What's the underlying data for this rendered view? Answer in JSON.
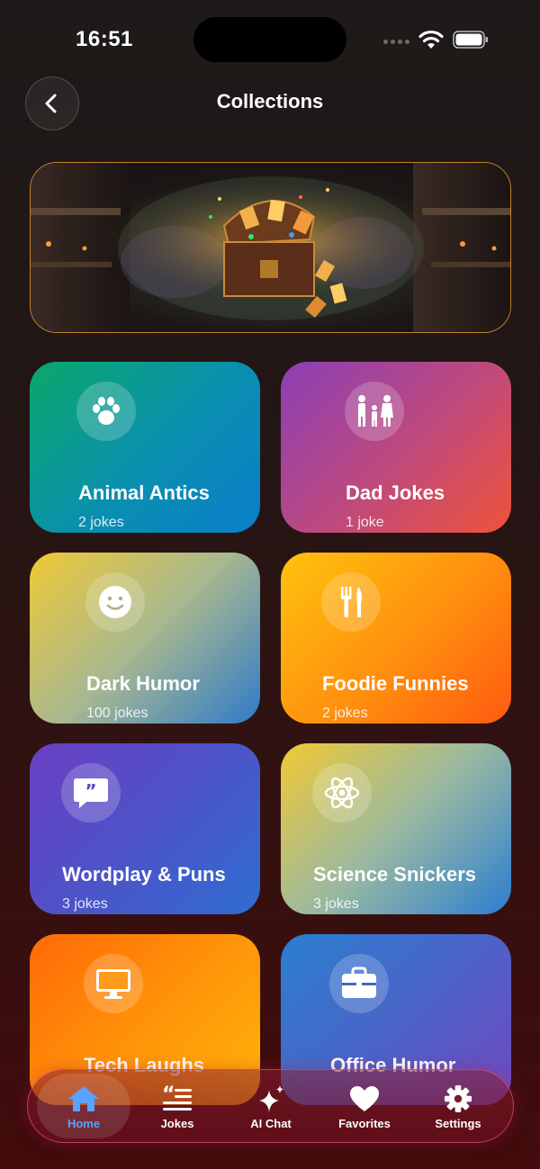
{
  "status_bar": {
    "time": "16:51"
  },
  "header": {
    "title": "Collections"
  },
  "banner": {
    "icon": "treasure-chest-image"
  },
  "collections": [
    {
      "title": "Animal Antics",
      "count": "2 jokes",
      "icon": "paw-icon",
      "colors": [
        "#0aa86a",
        "#0a7ec9"
      ]
    },
    {
      "title": "Dad Jokes",
      "count": "1 joke",
      "icon": "family-icon",
      "colors": [
        "#8b3fb6",
        "#ef5338"
      ]
    },
    {
      "title": "Dark Humor",
      "count": "100 jokes",
      "icon": "smiley-icon",
      "colors": [
        "#efc934",
        "#2f7bc8"
      ]
    },
    {
      "title": "Foodie Funnies",
      "count": "2 jokes",
      "icon": "fork-knife-icon",
      "colors": [
        "#ffc20e",
        "#ff5a10"
      ]
    },
    {
      "title": "Wordplay & Puns",
      "count": "3 jokes",
      "icon": "quote-bubble-icon",
      "colors": [
        "#6a3fc3",
        "#2e6dd2"
      ]
    },
    {
      "title": "Science Snickers",
      "count": "3 jokes",
      "icon": "atom-icon",
      "colors": [
        "#f1c935",
        "#2c7fd0"
      ]
    },
    {
      "title": "Tech Laughs",
      "count": "",
      "icon": "monitor-icon",
      "colors": [
        "#ff6a08",
        "#ffb40a"
      ]
    },
    {
      "title": "Office Humor",
      "count": "",
      "icon": "briefcase-icon",
      "colors": [
        "#2a7fd0",
        "#7049c0"
      ]
    }
  ],
  "tabs": [
    {
      "label": "Home",
      "icon": "home-icon",
      "active": true
    },
    {
      "label": "Jokes",
      "icon": "quote-list-icon",
      "active": false
    },
    {
      "label": "AI Chat",
      "icon": "sparkles-icon",
      "active": false
    },
    {
      "label": "Favorites",
      "icon": "heart-icon",
      "active": false
    },
    {
      "label": "Settings",
      "icon": "gear-icon",
      "active": false
    }
  ],
  "colors": {
    "accent": "#5aa2ff",
    "banner_border": "#c4822a",
    "tab_border": "#e65a78"
  }
}
